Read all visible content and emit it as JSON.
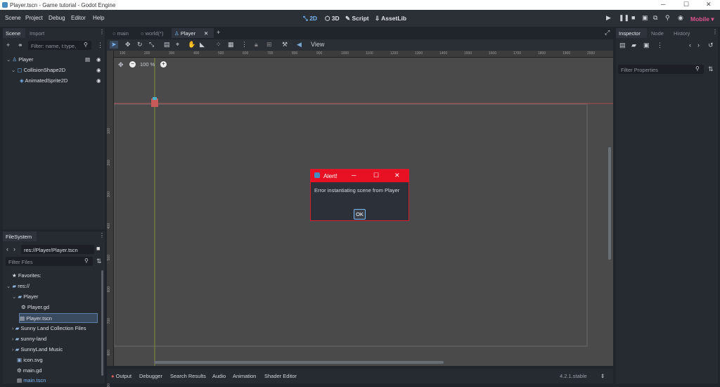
{
  "window": {
    "title": "Player.tscn - Game tutorial - Godot Engine"
  },
  "menu": {
    "items": [
      "Scene",
      "Project",
      "Debug",
      "Editor",
      "Help"
    ]
  },
  "modes": {
    "d2": "2D",
    "d3": "3D",
    "script": "Script",
    "assetlib": "AssetLib"
  },
  "renderer": "Mobile",
  "scene_dock": {
    "tabs": [
      "Scene",
      "Import"
    ],
    "filter_placeholder": "Filter: name, t:type,",
    "tree": [
      {
        "label": "Player"
      },
      {
        "label": "CollisionShape2D"
      },
      {
        "label": "AnimatedSprite2D"
      }
    ]
  },
  "filesystem": {
    "tab": "FileSystem",
    "path": "res://Player/Player.tscn",
    "filter_placeholder": "Filter Files",
    "items": [
      "Favorites:",
      "res://",
      "Player",
      "Player.gd",
      "Player.tscn",
      "Sunny Land Collection Files",
      "sunny-land",
      "SunnyLand Music",
      "icon.svg",
      "main.gd",
      "main.tscn"
    ]
  },
  "editor_tabs": [
    "main",
    "world(*)",
    "Player"
  ],
  "toolbar": {
    "view_label": "View"
  },
  "viewport": {
    "zoom": "100 %",
    "ruler_top": [
      "100",
      "200",
      "300",
      "400",
      "500",
      "600",
      "700",
      "800",
      "900",
      "1000",
      "1100",
      "1200",
      "1300",
      "1400",
      "1500",
      "1600",
      "1700",
      "1800",
      "1900",
      "2000"
    ],
    "ruler_left": [
      "100",
      "200",
      "300",
      "400",
      "500",
      "600",
      "700",
      "800",
      "900"
    ]
  },
  "dialog": {
    "title": "Alert!",
    "message": "Error instantiating scene from Player",
    "ok": "OK"
  },
  "bottom_tabs": [
    "Output",
    "Debugger",
    "Search Results",
    "Audio",
    "Animation",
    "Shader Editor"
  ],
  "version": "4.2.1.stable",
  "inspector": {
    "tabs": [
      "Inspector",
      "Node",
      "History"
    ],
    "filter_placeholder": "Filter Properties"
  },
  "colors": {
    "accent": "#7ab8f5",
    "alert_red": "#e81123",
    "renderer": "#e05590"
  }
}
